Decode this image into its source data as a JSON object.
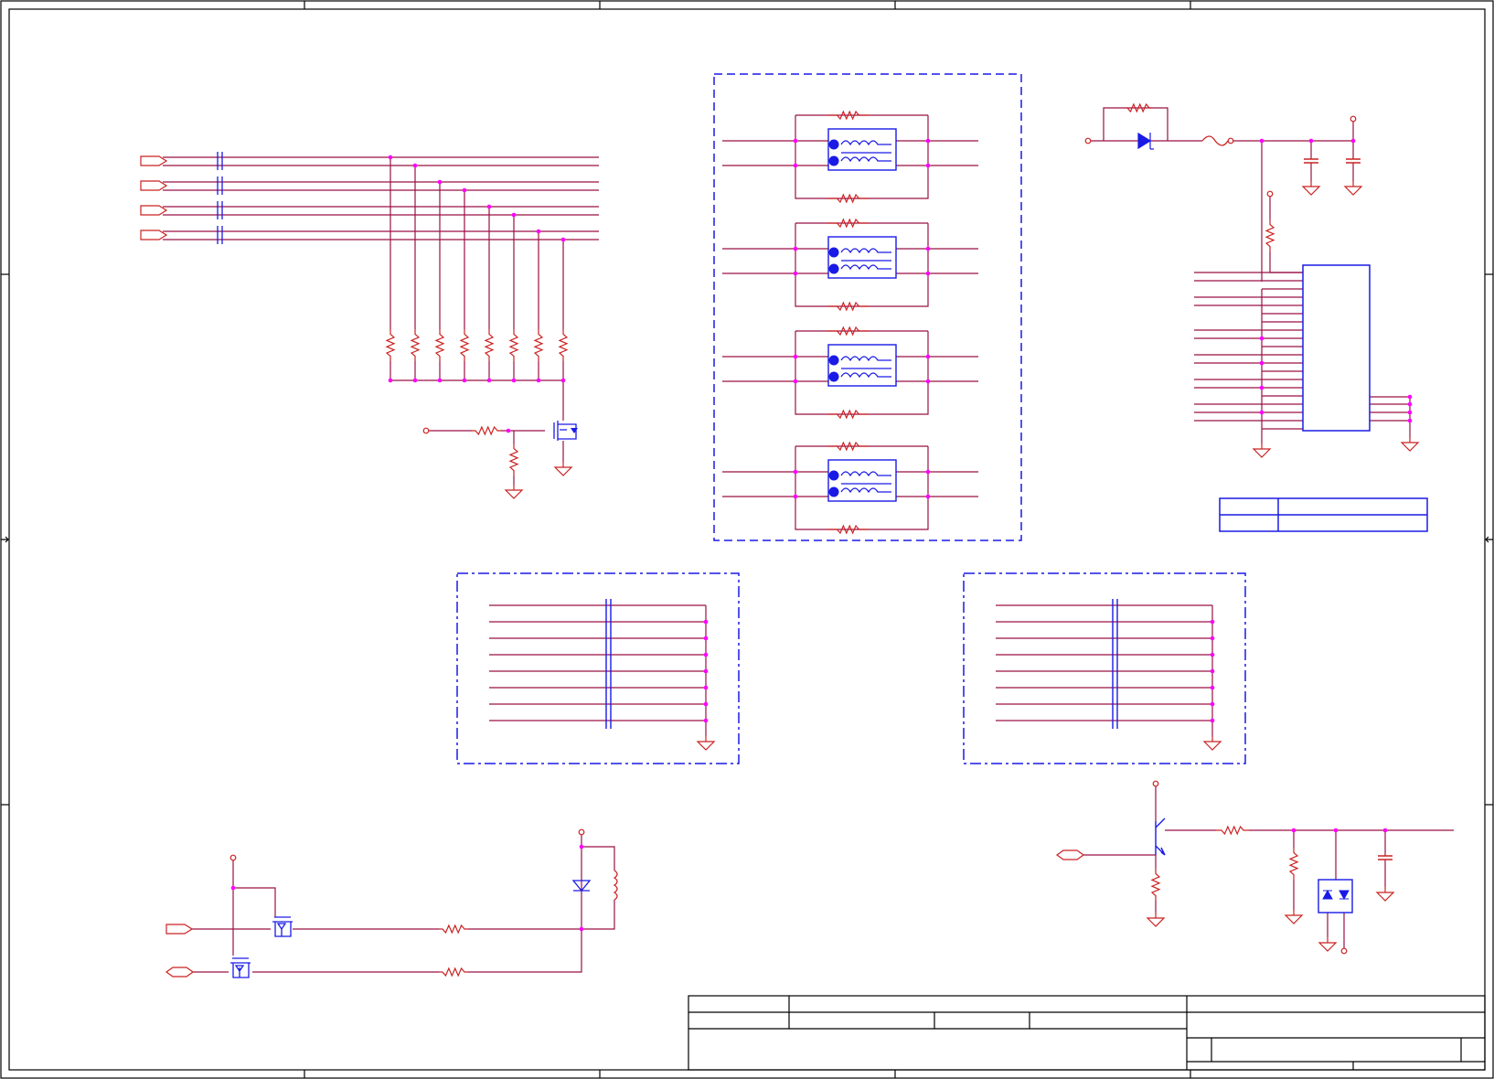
{
  "colors": {
    "wire": "#9a1045",
    "component": "#cc2222",
    "part": "#1a1ae6",
    "junction": "#ff00ff",
    "border": "#000000",
    "background": "#ffffff"
  },
  "title_block": {
    "rows": 4
  }
}
